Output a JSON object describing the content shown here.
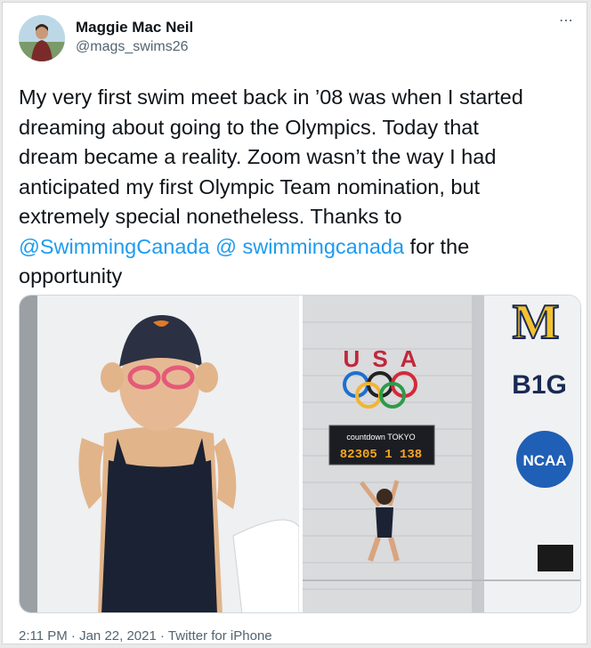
{
  "tweet": {
    "author_name": "Maggie Mac Neil",
    "author_handle": "@mags_swims26",
    "more_icon": "more-dots-icon",
    "text_lines": [
      "My very first swim meet back in ’08 was when I started",
      "dreaming about going to the Olympics. Today that",
      "dream became a reality. Zoom wasn’t the way I had",
      "anticipated my first Olympic Team nomination, but",
      "extremely special nonetheless. Thanks to"
    ],
    "mention1": "@SwimmingCanada",
    "mention_sep": " ",
    "mention2": "@ swimmingcanada",
    "text_after": " for the",
    "text_last": "opportunity",
    "time": "2:11 PM",
    "dot": " · ",
    "date": "Jan 22, 2021",
    "source": "Twitter for iPhone"
  },
  "media": {
    "usa_letters": "USA",
    "countdown_label": "countdown TOKYO",
    "countdown_value": "82305 1 138",
    "big_text": "B1G",
    "ncaa_text": "NCAA",
    "m_text": "M"
  }
}
